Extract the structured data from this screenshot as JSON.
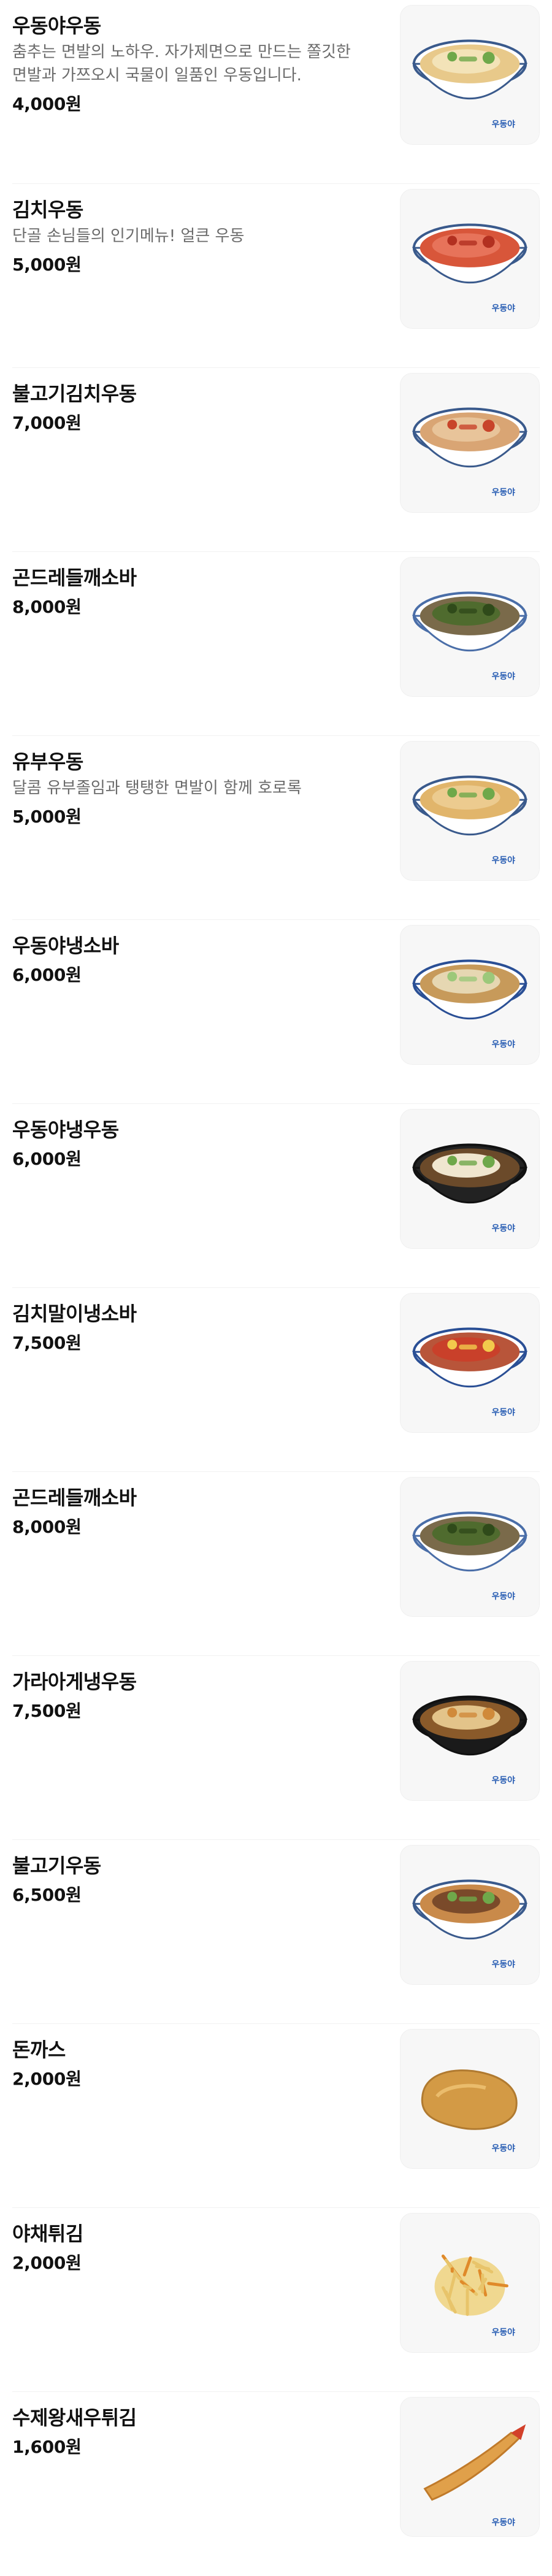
{
  "menu": {
    "items": [
      {
        "name": "우동야우동",
        "desc": "춤추는 면발의 노하우. 자가제면으로 만드는 쫄깃한 면발과 가쯔오시 국물이 일품인 우동입니다.",
        "price": "4,000원",
        "icon": "udon-bowl-icon"
      },
      {
        "name": "김치우동",
        "desc": "단골 손님들의 인기메뉴! 얼큰 우동",
        "price": "5,000원",
        "icon": "kimchi-udon-icon"
      },
      {
        "name": "불고기김치우동",
        "desc": "",
        "price": "7,000원",
        "icon": "bulgogi-kimchi-udon-icon"
      },
      {
        "name": "곤드레들깨소바",
        "desc": "",
        "price": "8,000원",
        "icon": "gondre-soba-icon"
      },
      {
        "name": "유부우동",
        "desc": "달콤 유부졸임과 탱탱한 면발이 함께 호로록",
        "price": "5,000원",
        "icon": "yubu-udon-icon"
      },
      {
        "name": "우동야냉소바",
        "desc": "",
        "price": "6,000원",
        "icon": "cold-soba-icon"
      },
      {
        "name": "우동야냉우동",
        "desc": "",
        "price": "6,000원",
        "icon": "cold-udon-icon"
      },
      {
        "name": "김치말이냉소바",
        "desc": "",
        "price": "7,500원",
        "icon": "kimchi-cold-soba-icon"
      },
      {
        "name": "곤드레들깨소바",
        "desc": "",
        "price": "8,000원",
        "icon": "gondre-soba-icon"
      },
      {
        "name": "가라아게냉우동",
        "desc": "",
        "price": "7,500원",
        "icon": "karaage-cold-udon-icon"
      },
      {
        "name": "불고기우동",
        "desc": "",
        "price": "6,500원",
        "icon": "bulgogi-udon-icon"
      },
      {
        "name": "돈까스",
        "desc": "",
        "price": "2,000원",
        "icon": "donkatsu-icon"
      },
      {
        "name": "야채튀김",
        "desc": "",
        "price": "2,000원",
        "icon": "vegetable-tempura-icon"
      },
      {
        "name": "수제왕새우튀김",
        "desc": "",
        "price": "1,600원",
        "icon": "shrimp-tempura-icon"
      }
    ]
  },
  "brand": {
    "logo_text": "우동야"
  },
  "colors": {
    "text_primary": "#111111",
    "text_secondary": "#6b6b6b",
    "divider": "#f0f0f0",
    "thumb_bg": "#f7f7f7",
    "logo_blue": "#2b5fb4"
  }
}
